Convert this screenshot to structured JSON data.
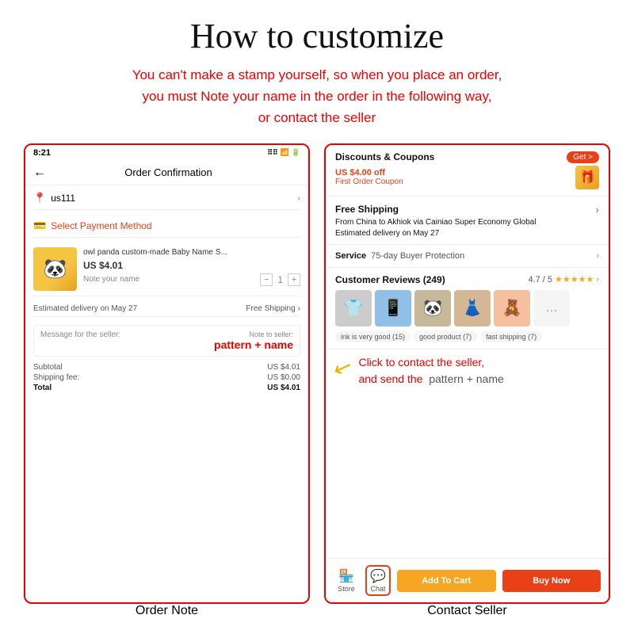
{
  "title": "How to customize",
  "subtitle_line1": "You can't make a stamp yourself, so when you place an order,",
  "subtitle_line2": "you must Note your name in the order in the following way,",
  "subtitle_line3": "or contact the seller",
  "left_panel": {
    "status_time": "8:21",
    "status_icons": "⠿ ⠿ ▌",
    "header_title": "Order Confirmation",
    "address": "us111",
    "payment_label": "Select Payment Method",
    "product_name": "owl panda custom-made Baby Name S...",
    "product_price": "US $4.01",
    "note_placeholder": "Note your name",
    "qty": "1",
    "delivery_label": "Estimated delivery on May 27",
    "free_shipping": "Free Shipping",
    "message_label": "Message for the seller:",
    "note_label": "Note to seller:",
    "note_highlight": "pattern + name",
    "subtotal_label": "Subtotal",
    "subtotal_value": "US $4.01",
    "shipping_label": "Shipping fee:",
    "shipping_value": "US $0.00",
    "total_label": "Total",
    "total_value": "US $4.01"
  },
  "right_panel": {
    "discount_title": "Discounts & Coupons",
    "get_label": "Get >",
    "discount_amount": "US $4.00 off",
    "discount_sub": "First Order Coupon",
    "shipping_title": "Free Shipping",
    "shipping_detail": "From China to Akhiok via Cainiao Super Economy Global",
    "shipping_estimate": "Estimated delivery on May 27",
    "service_label": "Service",
    "service_value": "75-day Buyer Protection",
    "reviews_title": "Customer Reviews (249)",
    "rating": "4.7 / 5",
    "review_tags": [
      "ink is very good (15)",
      "good product (7)",
      "fast shipping (7)"
    ],
    "store_label": "Store",
    "chat_label": "Chat",
    "add_to_cart": "Add To Cart",
    "buy_now": "Buy Now",
    "annotation_line1": "Click to contact the seller,",
    "annotation_line2": "and send the  pattern + name"
  },
  "left_caption": "Order Note",
  "right_caption": "Contact Seller"
}
